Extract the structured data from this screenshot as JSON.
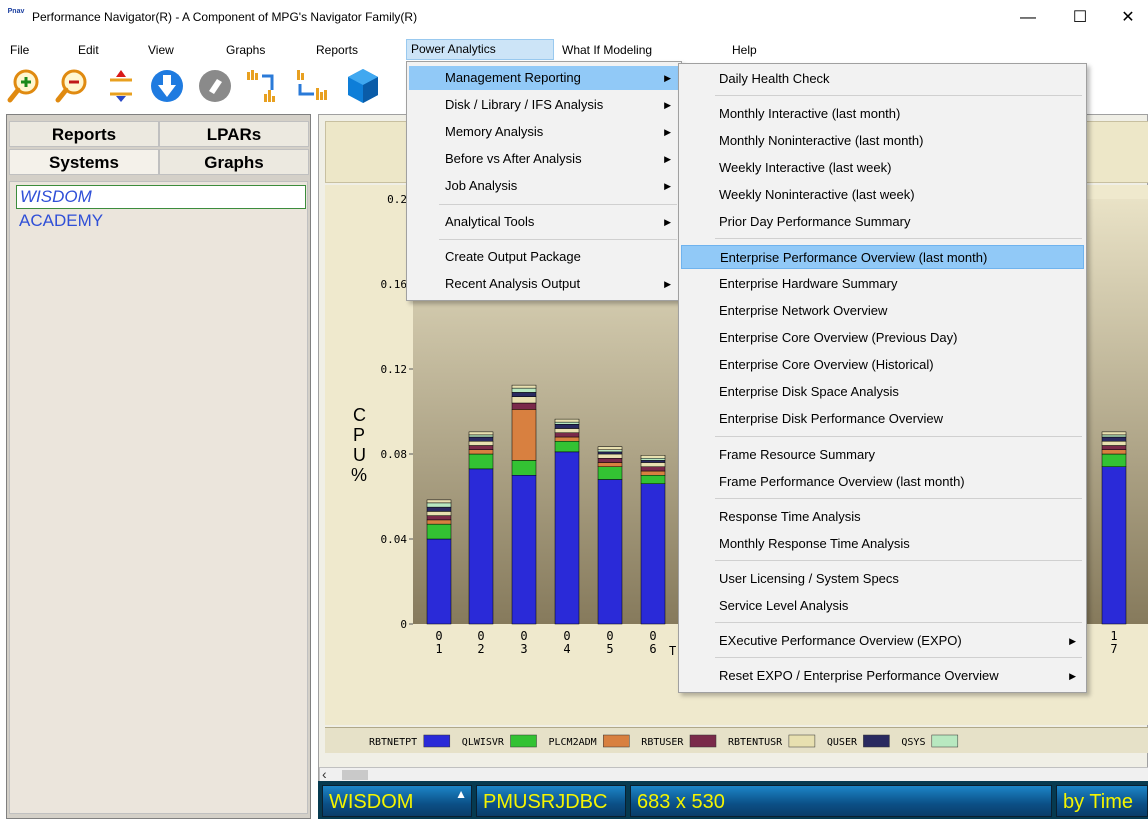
{
  "window": {
    "title": "Performance Navigator(R) - A Component of MPG's Navigator Family(R)",
    "icon_label": "Pnav",
    "minimize": "—",
    "maximize": "☐",
    "close": "✕"
  },
  "menubar": {
    "items": [
      "File",
      "Edit",
      "View",
      "Graphs",
      "Reports",
      "Power Analytics",
      "What If  Modeling",
      "Help"
    ]
  },
  "toolbar": {
    "icons": [
      "zoom-in-icon",
      "zoom-out-icon",
      "expand-vertical-icon",
      "download-icon",
      "tag-icon",
      "chart-swap-icon",
      "chart-rotate-icon",
      "cube-icon"
    ]
  },
  "left_pane": {
    "tabs": [
      "Reports",
      "LPARs",
      "Systems",
      "Graphs"
    ],
    "systems": [
      "WISDOM",
      "ACADEMY"
    ]
  },
  "power_analytics_menu": {
    "items": [
      {
        "label": "Management Reporting",
        "submenu": true,
        "highlighted": true
      },
      {
        "label": "Disk / Library / IFS Analysis",
        "submenu": true
      },
      {
        "label": "Memory Analysis",
        "submenu": true
      },
      {
        "label": "Before vs After Analysis",
        "submenu": true
      },
      {
        "label": "Job Analysis",
        "submenu": true
      },
      {
        "label": "Analytical Tools",
        "submenu": true
      },
      {
        "label": "Create Output Package",
        "submenu": false
      },
      {
        "label": "Recent Analysis Output",
        "submenu": true
      }
    ]
  },
  "management_reporting_submenu": {
    "items": [
      {
        "label": "Daily Health Check"
      },
      {
        "label": "Monthly Interactive (last month)"
      },
      {
        "label": "Monthly Noninteractive (last month)"
      },
      {
        "label": "Weekly Interactive (last week)"
      },
      {
        "label": "Weekly Noninteractive (last week)"
      },
      {
        "label": "Prior Day Performance Summary"
      },
      {
        "label": "Enterprise Performance Overview (last month)",
        "highlighted": true
      },
      {
        "label": "Enterprise Hardware Summary"
      },
      {
        "label": "Enterprise Network Overview"
      },
      {
        "label": "Enterprise Core Overview (Previous Day)"
      },
      {
        "label": "Enterprise Core Overview (Historical)"
      },
      {
        "label": "Enterprise Disk Space Analysis"
      },
      {
        "label": "Enterprise Disk Performance Overview"
      },
      {
        "label": "Frame Resource Summary"
      },
      {
        "label": "Frame Performance Overview (last month)"
      },
      {
        "label": "Response Time Analysis"
      },
      {
        "label": "Monthly Response Time Analysis"
      },
      {
        "label": "User Licensing / System Specs"
      },
      {
        "label": "Service Level Analysis"
      },
      {
        "label": "EXecutive Performance Overview (EXPO)",
        "submenu": true
      },
      {
        "label": "Reset EXPO / Enterprise Performance Overview",
        "submenu": true
      }
    ]
  },
  "chart_data": {
    "type": "bar",
    "ylabel": "CPU %",
    "xlabel": "T",
    "ylim": [
      0,
      0.2
    ],
    "y_ticks": [
      "0",
      "0.04",
      "0.08",
      "0.12",
      "0.16",
      "0.2"
    ],
    "categories": [
      "01",
      "02",
      "03",
      "04",
      "05",
      "06",
      "17"
    ],
    "series": [
      {
        "name": "RBTNETPT",
        "color": "#2a2ad8",
        "values": [
          0.04,
          0.073,
          0.07,
          0.081,
          0.068,
          0.066,
          0.074
        ]
      },
      {
        "name": "QLWISVR",
        "color": "#33c233",
        "values": [
          0.007,
          0.007,
          0.007,
          0.005,
          0.006,
          0.004,
          0.006
        ]
      },
      {
        "name": "PLCM2ADM",
        "color": "#d88040",
        "values": [
          0.002,
          0.002,
          0.024,
          0.002,
          0.002,
          0.002,
          0.002
        ]
      },
      {
        "name": "RBTUSER",
        "color": "#7a2a4a",
        "values": [
          0.002,
          0.002,
          0.003,
          0.002,
          0.002,
          0.002,
          0.002
        ]
      },
      {
        "name": "RBTENTUSR",
        "color": "#e8e0b0",
        "values": [
          0.002,
          0.002,
          0.003,
          0.002,
          0.002,
          0.002,
          0.002
        ]
      },
      {
        "name": "QUSER",
        "color": "#2a2a60",
        "values": [
          0.002,
          0.002,
          0.002,
          0.002,
          0.001,
          0.001,
          0.002
        ]
      },
      {
        "name": "QSYS",
        "color": "#b8e8c0",
        "values": [
          0.002,
          0.001,
          0.002,
          0.001,
          0.001,
          0.001,
          0.001
        ]
      }
    ],
    "legend_placement": "bottom"
  },
  "status": {
    "system": "WISDOM",
    "job": "PMUSRJDBC",
    "size": "683 x 530",
    "mode": "by Time"
  },
  "colors": {
    "menu_highlight": "#91c9f7",
    "status_text": "#f4f400",
    "system_text": "#2f4fd7"
  }
}
